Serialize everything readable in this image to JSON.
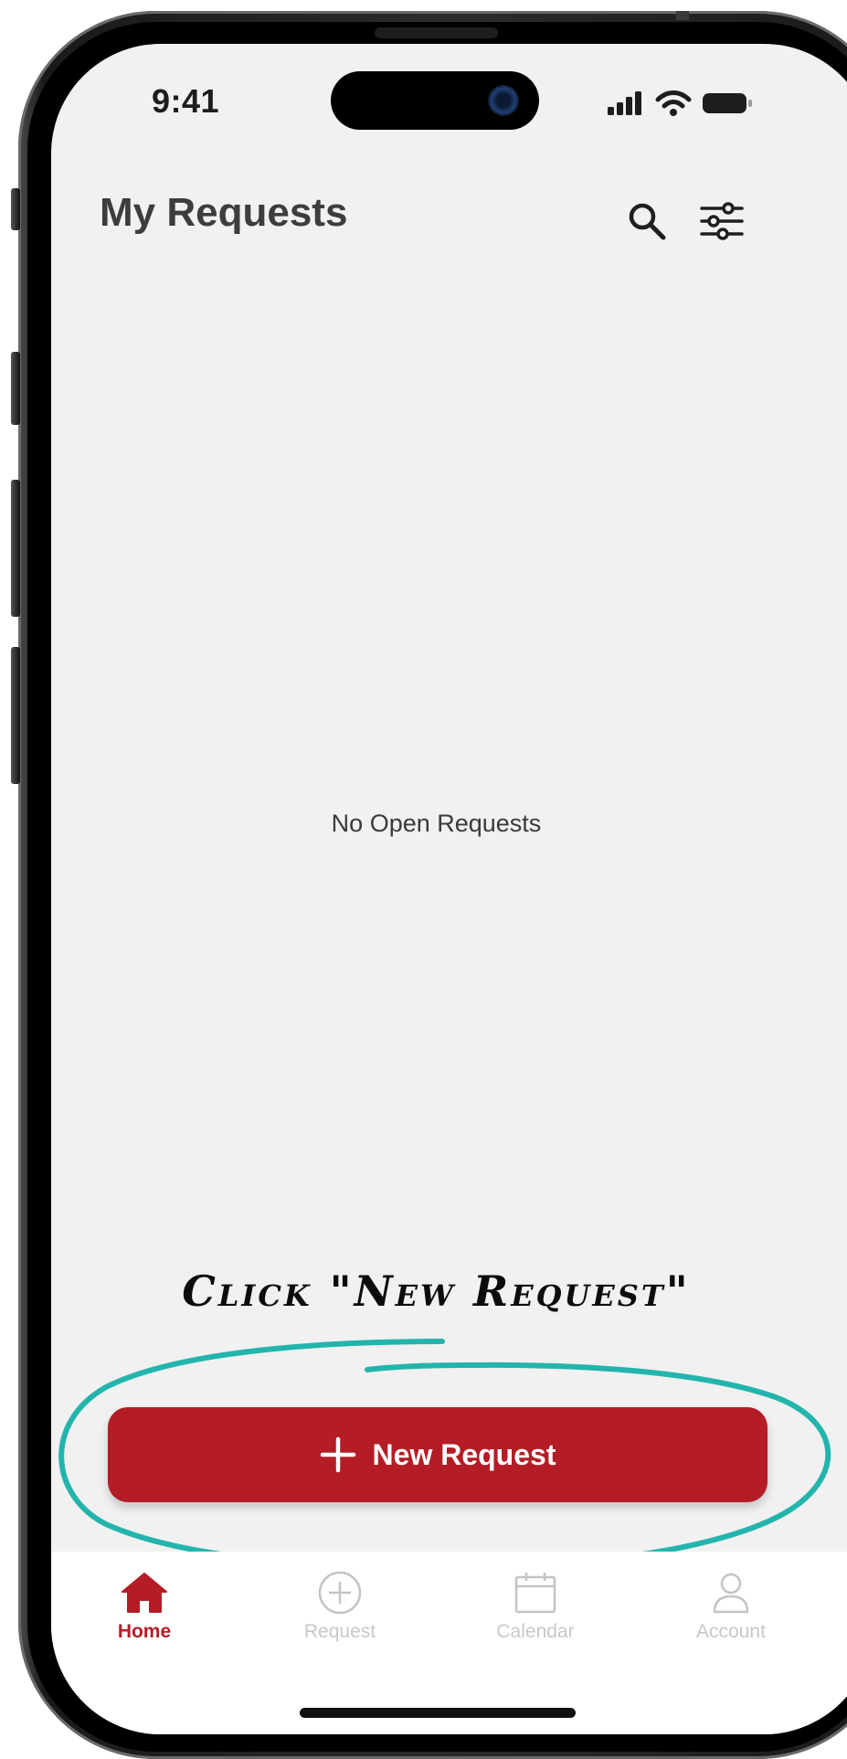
{
  "status_bar": {
    "time": "9:41"
  },
  "header": {
    "title": "My Requests",
    "search_icon": "search-icon",
    "filter_icon": "sliders-icon"
  },
  "main": {
    "empty_message": "No Open Requests"
  },
  "annotation": {
    "text": "Click \"New Request\"",
    "color": "#23b5ad"
  },
  "new_request_button": {
    "label": "New Request",
    "icon": "plus-icon",
    "color": "#b41d26"
  },
  "tab_bar": {
    "items": [
      {
        "label": "Home",
        "icon": "home-icon",
        "active": true
      },
      {
        "label": "Request",
        "icon": "plus-circle-icon",
        "active": false
      },
      {
        "label": "Calendar",
        "icon": "calendar-icon",
        "active": false
      },
      {
        "label": "Account",
        "icon": "user-icon",
        "active": false
      }
    ]
  }
}
